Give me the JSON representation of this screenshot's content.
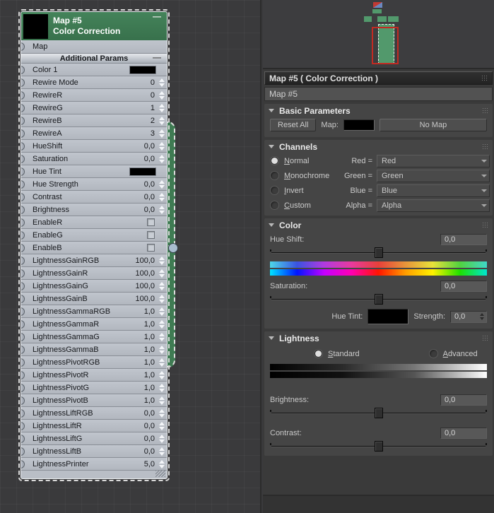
{
  "colors": {
    "node_header_green": "#3e7a52",
    "selection_dash": "#d9d9d9",
    "navigator_node_green": "#52996c",
    "navigator_view_frame_red": "#c22a22"
  },
  "node": {
    "title": "Map #5",
    "subtitle": "Color Correction",
    "collapse_glyph": "—",
    "map_slot_label": "Map",
    "section_label": "Additional Params",
    "section_collapse_glyph": "—",
    "rows": [
      {
        "label": "Color 1",
        "type": "color"
      },
      {
        "label": "Rewire Mode",
        "type": "value",
        "value": "0"
      },
      {
        "label": "RewireR",
        "type": "value",
        "value": "0"
      },
      {
        "label": "RewireG",
        "type": "value",
        "value": "1"
      },
      {
        "label": "RewireB",
        "type": "value",
        "value": "2"
      },
      {
        "label": "RewireA",
        "type": "value",
        "value": "3"
      },
      {
        "label": "HueShift",
        "type": "value",
        "value": "0,0"
      },
      {
        "label": "Saturation",
        "type": "value",
        "value": "0,0"
      },
      {
        "label": "Hue Tint",
        "type": "color"
      },
      {
        "label": "Hue Strength",
        "type": "value",
        "value": "0,0"
      },
      {
        "label": "Contrast",
        "type": "value",
        "value": "0,0"
      },
      {
        "label": "Brightness",
        "type": "value",
        "value": "0,0"
      },
      {
        "label": "EnableR",
        "type": "check"
      },
      {
        "label": "EnableG",
        "type": "check"
      },
      {
        "label": "EnableB",
        "type": "check"
      },
      {
        "label": "LightnessGainRGB",
        "type": "value",
        "value": "100,0"
      },
      {
        "label": "LightnessGainR",
        "type": "value",
        "value": "100,0"
      },
      {
        "label": "LightnessGainG",
        "type": "value",
        "value": "100,0"
      },
      {
        "label": "LightnessGainB",
        "type": "value",
        "value": "100,0"
      },
      {
        "label": "LightnessGammaRGB",
        "type": "value",
        "value": "1,0"
      },
      {
        "label": "LightnessGammaR",
        "type": "value",
        "value": "1,0"
      },
      {
        "label": "LightnessGammaG",
        "type": "value",
        "value": "1,0"
      },
      {
        "label": "LightnessGammaB",
        "type": "value",
        "value": "1,0"
      },
      {
        "label": "LightnessPivotRGB",
        "type": "value",
        "value": "1,0"
      },
      {
        "label": "LightnessPivotR",
        "type": "value",
        "value": "1,0"
      },
      {
        "label": "LightnessPivotG",
        "type": "value",
        "value": "1,0"
      },
      {
        "label": "LightnessPivotB",
        "type": "value",
        "value": "1,0"
      },
      {
        "label": "LightnessLiftRGB",
        "type": "value",
        "value": "0,0"
      },
      {
        "label": "LightnessLiftR",
        "type": "value",
        "value": "0,0"
      },
      {
        "label": "LightnessLiftG",
        "type": "value",
        "value": "0,0"
      },
      {
        "label": "LightnessLiftB",
        "type": "value",
        "value": "0,0"
      },
      {
        "label": "LightnessPrinter",
        "type": "value",
        "value": "5,0"
      }
    ]
  },
  "panel": {
    "title": "Map #5  ( Color Correction )",
    "name_field_value": "Map #5",
    "basic": {
      "header": "Basic Parameters",
      "reset_button": "Reset All",
      "map_label": "Map:",
      "no_map_button": "No Map"
    },
    "channels": {
      "header": "Channels",
      "rows": [
        {
          "mode": "Normal",
          "selected": true,
          "chan": "Red =",
          "value": "Red"
        },
        {
          "mode": "Monochrome",
          "selected": false,
          "chan": "Green =",
          "value": "Green"
        },
        {
          "mode": "Invert",
          "selected": false,
          "chan": "Blue =",
          "value": "Blue"
        },
        {
          "mode": "Custom",
          "selected": false,
          "chan": "Alpha =",
          "value": "Alpha"
        }
      ]
    },
    "color": {
      "header": "Color",
      "hue_shift_label": "Hue Shift:",
      "hue_shift_value": "0,0",
      "saturation_label": "Saturation:",
      "saturation_value": "0,0",
      "hue_tint_label": "Hue Tint:",
      "strength_label": "Strength:",
      "strength_value": "0,0"
    },
    "lightness": {
      "header": "Lightness",
      "standard_label": "Standard",
      "advanced_label": "Advanced",
      "brightness_label": "Brightness:",
      "brightness_value": "0,0",
      "contrast_label": "Contrast:",
      "contrast_value": "0,0"
    }
  }
}
